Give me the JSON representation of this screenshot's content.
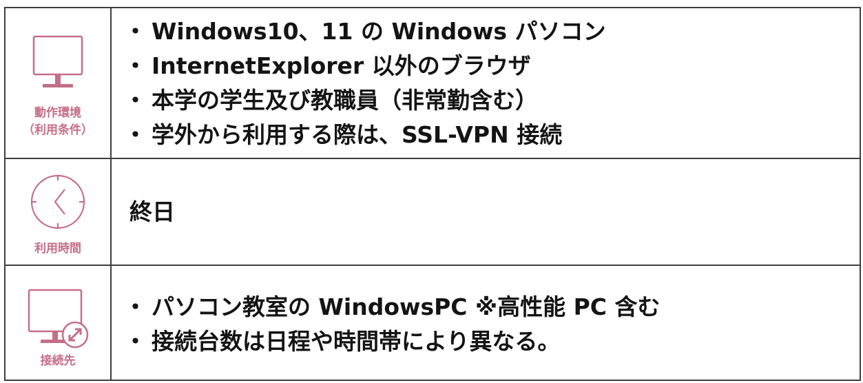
{
  "colors": {
    "accent": "#c56e88",
    "border": "#3d3d3d",
    "text": "#141414"
  },
  "rows": [
    {
      "icon": "monitor-icon",
      "label_lines": [
        "動作環境",
        "（利用条件）"
      ],
      "bullet": "・",
      "lines": [
        "Windows10、11 の Windows パソコン",
        "InternetExplorer 以外のブラウザ",
        "本学の学生及び教職員（非常勤含む）",
        "学外から利用する際は、SSL-VPN 接続"
      ]
    },
    {
      "icon": "clock-icon",
      "label_lines": [
        "利用時間"
      ],
      "lines": [
        "終日"
      ]
    },
    {
      "icon": "remote-desktop-icon",
      "label_lines": [
        "接続先"
      ],
      "bullet": "・",
      "lines": [
        "パソコン教室の WindowsPC ※高性能 PC 含む",
        "接続台数は日程や時間帯により異なる。"
      ]
    }
  ]
}
